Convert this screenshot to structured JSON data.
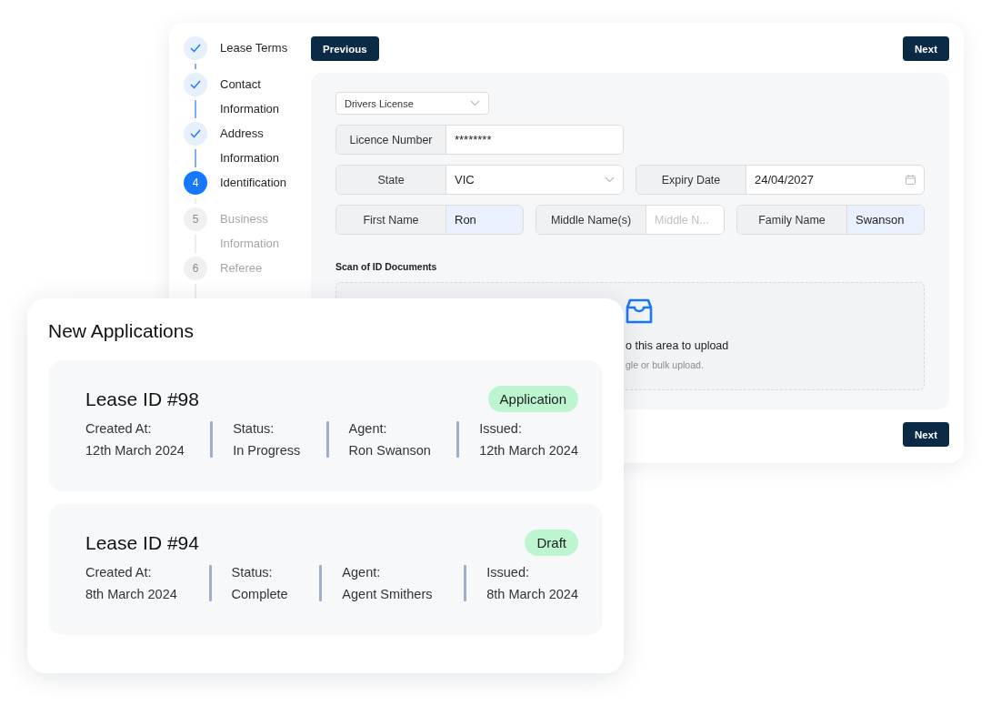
{
  "wizard": {
    "previous_button": "Previous",
    "next_button_top": "Next",
    "next_button_bottom": "Next",
    "steps": [
      {
        "label": "Lease Terms",
        "completed": true,
        "current": false
      },
      {
        "label": "Contact Information",
        "completed": true,
        "current": false
      },
      {
        "label": "Address Information",
        "completed": true,
        "current": false
      },
      {
        "label": "Identification",
        "completed": false,
        "current": true,
        "number": "4"
      },
      {
        "label": "Business Information",
        "completed": false,
        "current": false,
        "number": "5"
      },
      {
        "label": "Referee",
        "completed": false,
        "current": false,
        "number": "6"
      }
    ],
    "document_type": {
      "value": "Drivers License"
    },
    "field_rows": [
      [
        {
          "kind": "text",
          "label": "Licence Number",
          "value": "********",
          "highlighted": false
        }
      ],
      [
        {
          "kind": "select",
          "label": "State",
          "value": "VIC",
          "highlighted": false
        },
        {
          "kind": "date",
          "label": "Expiry Date",
          "value": "24/04/2027",
          "highlighted": false
        }
      ],
      [
        {
          "kind": "text",
          "label": "First Name",
          "value": "Ron",
          "highlighted": true
        },
        {
          "kind": "text",
          "label": "Middle Name(s)",
          "placeholder": "Middle N...",
          "highlighted": false
        },
        {
          "kind": "text",
          "label": "Family Name",
          "value": "Swanson",
          "highlighted": true
        }
      ]
    ],
    "scan_label": "Scan of ID Documents",
    "upload": {
      "text": "o this area to upload",
      "hint": "gle or bulk upload."
    }
  },
  "applications": {
    "title": "New Applications",
    "items": [
      {
        "lease_id": "Lease ID #98",
        "badge": "Application",
        "details": [
          {
            "label": "Created At:",
            "value": "12th March 2024"
          },
          {
            "label": "Status:",
            "value": "In Progress"
          },
          {
            "label": "Agent:",
            "value": "Ron Swanson"
          },
          {
            "label": "Issued:",
            "value": "12th March 2024"
          }
        ]
      },
      {
        "lease_id": "Lease ID #94",
        "badge": "Draft",
        "details": [
          {
            "label": "Created At:",
            "value": "8th March 2024"
          },
          {
            "label": "Status:",
            "value": "Complete"
          },
          {
            "label": "Agent:",
            "value": "Agent Smithers"
          },
          {
            "label": "Issued:",
            "value": "8th March 2024"
          }
        ]
      }
    ]
  }
}
